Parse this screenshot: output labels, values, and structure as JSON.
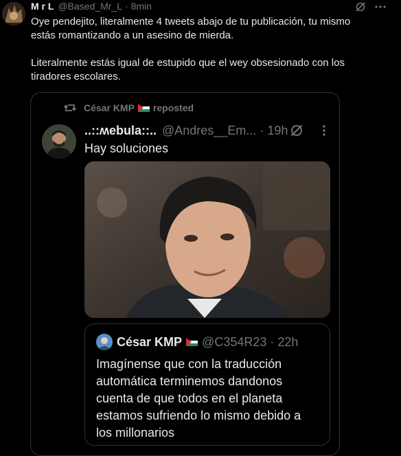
{
  "reply": {
    "author_name": "M r L",
    "author_handle": "@Based_Mr_L",
    "time": "· 8min",
    "body_line_1": "Oye pendejito, literalmente 4 tweets abajo de tu publicación, tu mismo",
    "body_line_2": "estás romantizando a un asesino de mierda.",
    "body_line_3": "Literalmente estás igual de estupido que el wey obsesionado con los",
    "body_line_4": "tiradores escolares."
  },
  "embedded": {
    "repost_label": "César KMP",
    "repost_suffix": "reposted",
    "author_name": "..::ʍebula::..",
    "author_handle": "@Andres__Em...",
    "time": "· 19h",
    "text": "Hay soluciones",
    "quote": {
      "author_name": "César KMP",
      "author_handle": "@C354R23",
      "time": "· 22h",
      "line_1": "Imagínense que con la traducción",
      "line_2": "automática terminemos dandonos",
      "line_3": "cuenta de que todos en el planeta",
      "line_4": "estamos sufriendo lo mismo debido a",
      "line_5": "los millonarios"
    }
  },
  "icons": [
    "grok-icon",
    "more-icon",
    "repost-icon",
    "palestine-flag-icon"
  ],
  "colors": {
    "background": "#000000",
    "text": "#e7e9ea",
    "muted": "#71767b",
    "border": "#2f3336"
  }
}
